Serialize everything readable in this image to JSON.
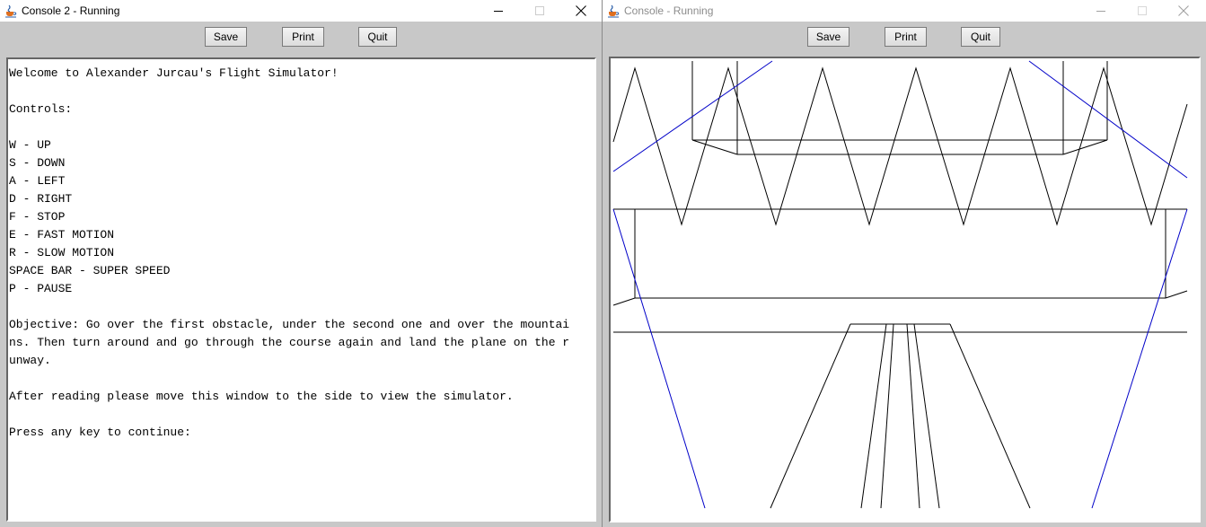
{
  "left_window": {
    "title": "Console 2 - Running",
    "icon": "java-cup-icon",
    "toolbar": {
      "save_label": "Save",
      "print_label": "Print",
      "quit_label": "Quit"
    },
    "console_text": "Welcome to Alexander Jurcau's Flight Simulator!\n\nControls:\n\nW - UP\nS - DOWN\nA - LEFT\nD - RIGHT\nF - STOP\nE - FAST MOTION\nR - SLOW MOTION\nSPACE BAR - SUPER SPEED\nP - PAUSE\n\nObjective: Go over the first obstacle, under the second one and over the mountai\nns. Then turn around and go through the course again and land the plane on the r\nunway.\n\nAfter reading please move this window to the side to view the simulator.\n\nPress any key to continue:"
  },
  "right_window": {
    "title": "Console - Running",
    "icon": "java-cup-icon",
    "toolbar": {
      "save_label": "Save",
      "print_label": "Print",
      "quit_label": "Quit"
    },
    "colors": {
      "wire": "#000000",
      "blue_wire": "#0000c8"
    }
  },
  "window_controls": [
    "minimize-icon",
    "maximize-icon",
    "close-icon"
  ]
}
